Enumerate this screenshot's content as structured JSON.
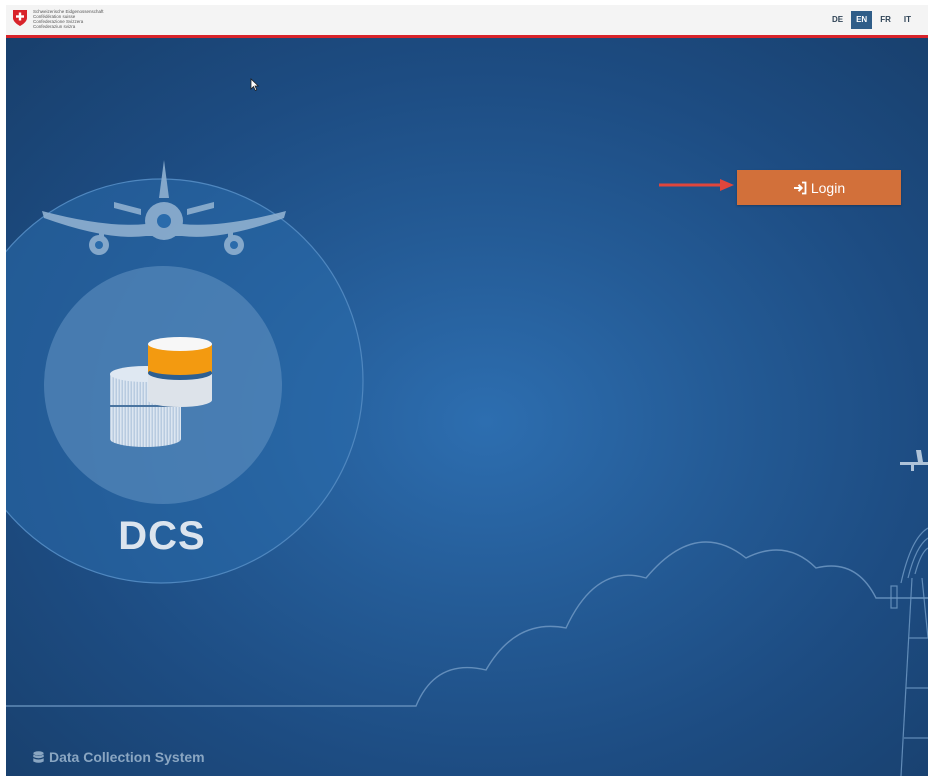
{
  "header": {
    "confederation_lines": [
      "Schweizerische Eidgenossenschaft",
      "Confédération suisse",
      "Confederazione Svizzera",
      "Confederaziun svizra"
    ],
    "languages": [
      {
        "code": "DE",
        "active": false
      },
      {
        "code": "EN",
        "active": true
      },
      {
        "code": "FR",
        "active": false
      },
      {
        "code": "IT",
        "active": false
      }
    ]
  },
  "main": {
    "login_label": "Login",
    "app_abbreviation": "DCS",
    "app_name": "Data Collection System"
  },
  "colors": {
    "swiss_red": "#d8232a",
    "login_orange": "#d2703a",
    "database_orange": "#f39a10",
    "background_blue": "#245b96",
    "active_language_blue": "#2f5d88"
  },
  "icons": {
    "login": "sign-in-icon",
    "footer": "database-icon",
    "logo": "swiss-cross-crest-icon"
  }
}
